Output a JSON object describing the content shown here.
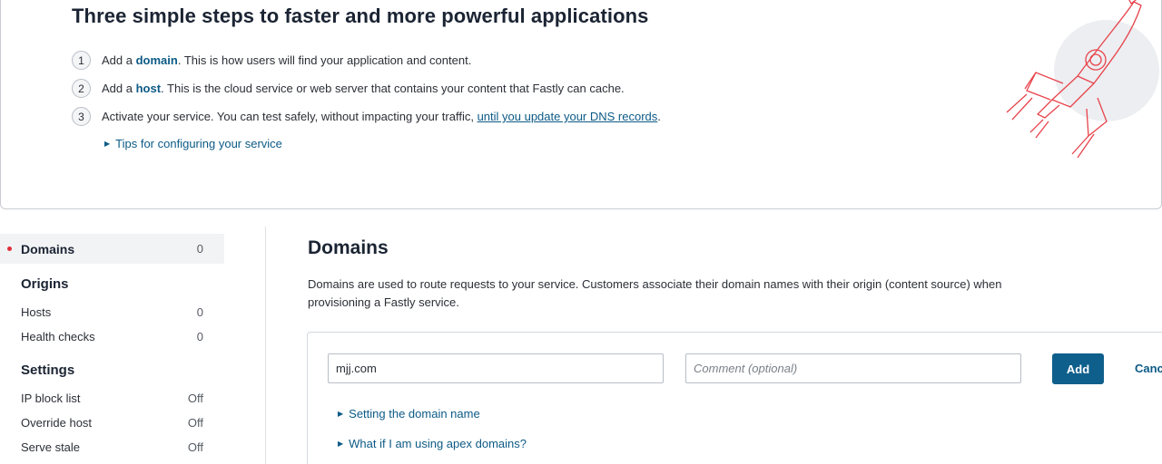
{
  "hero": {
    "title": "Three simple steps to faster and more powerful applications",
    "steps": [
      {
        "num": "1",
        "pre": "Add a ",
        "bold": "domain",
        "post": ". This is how users will find your application and content."
      },
      {
        "num": "2",
        "pre": "Add a ",
        "bold": "host",
        "post": ". This is the cloud service or web server that contains your content that Fastly can cache."
      },
      {
        "num": "3",
        "pre": "Activate your service. You can test safely, without impacting your traffic, ",
        "link": "until you update your DNS records",
        "post": "."
      }
    ],
    "tips_label": "Tips for configuring your service"
  },
  "sidebar": {
    "domains": {
      "label": "Domains",
      "count": "0"
    },
    "origins_heading": "Origins",
    "hosts": {
      "label": "Hosts",
      "count": "0"
    },
    "health_checks": {
      "label": "Health checks",
      "count": "0"
    },
    "settings_heading": "Settings",
    "ip_block_list": {
      "label": "IP block list",
      "value": "Off"
    },
    "override_host": {
      "label": "Override host",
      "value": "Off"
    },
    "serve_stale": {
      "label": "Serve stale",
      "value": "Off"
    }
  },
  "main": {
    "title": "Domains",
    "description": "Domains are used to route requests to your service. Customers associate their domain names with their origin (content source) when provisioning a Fastly service.",
    "domain_input": {
      "value": "mjj.com"
    },
    "comment_input": {
      "placeholder": "Comment (optional)"
    },
    "add_label": "Add",
    "cancel_label": "Cancel",
    "help_links": [
      "Setting the domain name",
      "What if I am using apex domains?"
    ]
  },
  "colors": {
    "accent": "#0c5a86",
    "button": "#0f5f8c",
    "active_dot": "#e0303a",
    "rocket": "#e8434b"
  }
}
